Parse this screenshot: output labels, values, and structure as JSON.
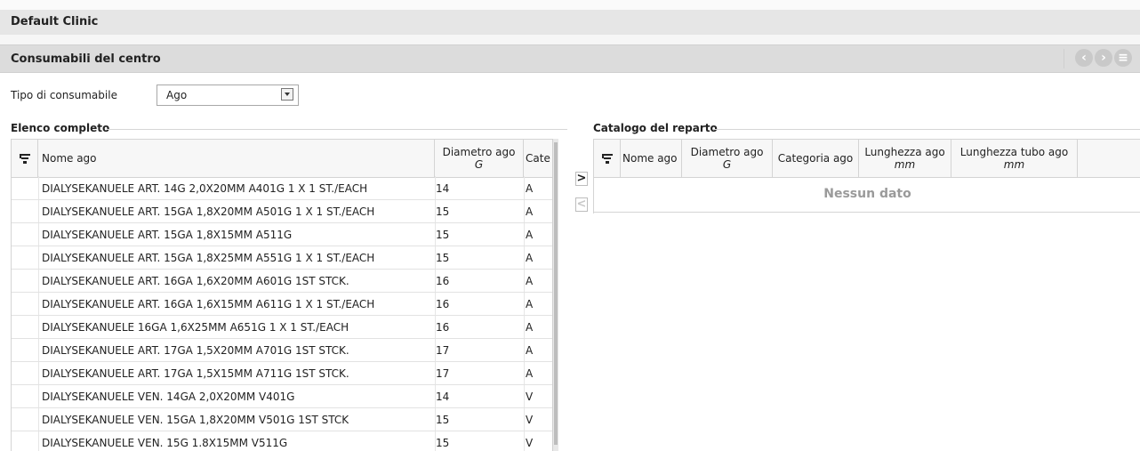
{
  "app": {
    "title": "Default Clinic"
  },
  "section": {
    "title": "Consumabili del centro"
  },
  "nav": {
    "prev_icon": "chevron-left-icon",
    "next_icon": "chevron-right-icon",
    "menu_icon": "menu-icon"
  },
  "filter": {
    "label": "Tipo di consumabile",
    "selected": "Ago"
  },
  "left_panel": {
    "title": "Elenco completo",
    "columns": [
      {
        "label": "Nome ago",
        "unit": ""
      },
      {
        "label": "Diametro ago",
        "unit": "G"
      },
      {
        "label": "Cate",
        "unit": ""
      }
    ],
    "rows": [
      {
        "name": "DIALYSEKANUELE ART. 14G 2,0X20MM A401G 1 X 1 ST./EACH",
        "diameter": "14",
        "category": "A"
      },
      {
        "name": "DIALYSEKANUELE ART. 15GA 1,8X20MM A501G 1 X 1 ST./EACH",
        "diameter": "15",
        "category": "A"
      },
      {
        "name": "DIALYSEKANUELE ART. 15GA 1,8X15MM A511G",
        "diameter": "15",
        "category": "A"
      },
      {
        "name": "DIALYSEKANUELE ART. 15GA 1,8X25MM A551G 1 X 1 ST./EACH",
        "diameter": "15",
        "category": "A"
      },
      {
        "name": "DIALYSEKANUELE ART. 16GA 1,6X20MM A601G 1ST STCK.",
        "diameter": "16",
        "category": "A"
      },
      {
        "name": "DIALYSEKANUELE ART. 16GA 1,6X15MM A611G 1 X 1 ST./EACH",
        "diameter": "16",
        "category": "A"
      },
      {
        "name": "DIALYSEKANUELE 16GA 1,6X25MM A651G 1 X 1 ST./EACH",
        "diameter": "16",
        "category": "A"
      },
      {
        "name": "DIALYSEKANUELE ART. 17GA 1,5X20MM A701G 1ST STCK.",
        "diameter": "17",
        "category": "A"
      },
      {
        "name": "DIALYSEKANUELE ART. 17GA 1,5X15MM A711G 1ST STCK.",
        "diameter": "17",
        "category": "A"
      },
      {
        "name": "DIALYSEKANUELE VEN. 14GA 2,0X20MM V401G",
        "diameter": "14",
        "category": "V"
      },
      {
        "name": "DIALYSEKANUELE VEN. 15GA 1,8X20MM V501G 1ST STCK",
        "diameter": "15",
        "category": "V"
      },
      {
        "name": "DIALYSEKANUELE VEN. 15G 1.8X15MM V511G",
        "diameter": "15",
        "category": "V"
      }
    ]
  },
  "transfer": {
    "add_label": ">",
    "remove_label": "<"
  },
  "right_panel": {
    "title": "Catalogo del reparto",
    "columns": [
      {
        "label": "Nome ago",
        "unit": ""
      },
      {
        "label": "Diametro ago",
        "unit": "G"
      },
      {
        "label": "Categoria ago",
        "unit": ""
      },
      {
        "label": "Lunghezza ago",
        "unit": "mm"
      },
      {
        "label": "Lunghezza tubo ago",
        "unit": "mm"
      }
    ],
    "empty_text": "Nessun dato"
  }
}
